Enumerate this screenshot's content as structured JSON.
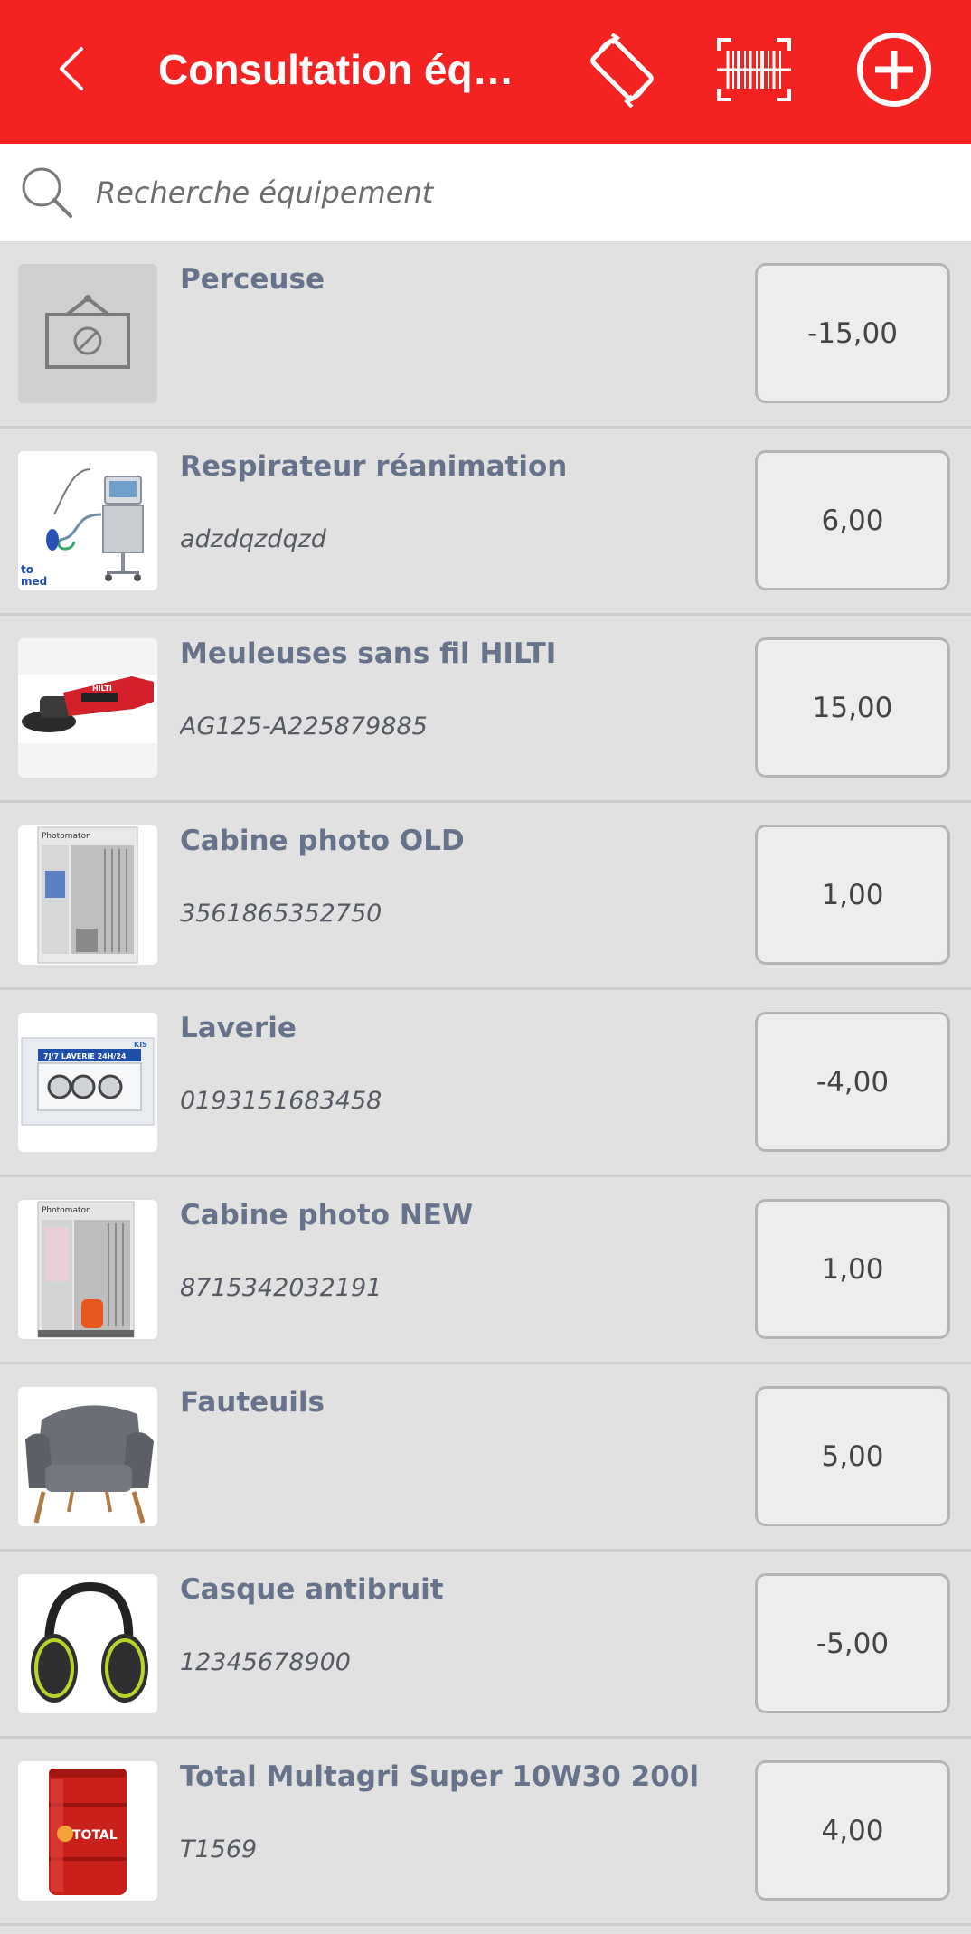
{
  "header": {
    "title": "Consultation équi...",
    "background": "#f52222"
  },
  "search": {
    "placeholder": "Recherche équipement"
  },
  "items": [
    {
      "name": "Perceuse",
      "ref": "",
      "qty": "-15,00",
      "image": "no-image-icon"
    },
    {
      "name": "Respirateur réanimation",
      "ref": "adzdqzdqzd",
      "qty": "6,00",
      "image": "ventilator-image"
    },
    {
      "name": "Meuleuses sans fil HILTI",
      "ref": "AG125-A225879885",
      "qty": "15,00",
      "image": "grinder-image"
    },
    {
      "name": "Cabine photo OLD",
      "ref": "3561865352750",
      "qty": "1,00",
      "image": "photo-booth-image"
    },
    {
      "name": "Laverie",
      "ref": "0193151683458",
      "qty": "-4,00",
      "image": "laundry-machine-image"
    },
    {
      "name": "Cabine photo NEW",
      "ref": "8715342032191",
      "qty": "1,00",
      "image": "photo-booth-image"
    },
    {
      "name": "Fauteuils",
      "ref": "",
      "qty": "5,00",
      "image": "armchair-image"
    },
    {
      "name": "Casque antibruit",
      "ref": "12345678900",
      "qty": "-5,00",
      "image": "earmuffs-image"
    },
    {
      "name": "Total Multagri Super 10W30 200l",
      "ref": "T1569",
      "qty": "4,00",
      "image": "oil-drum-image"
    }
  ],
  "thumb_text": {
    "photomaton": "Photomaton",
    "laverie_banner": "7J/7 LAVERIE 24H/24",
    "total": "TOTAL",
    "med": "med"
  }
}
